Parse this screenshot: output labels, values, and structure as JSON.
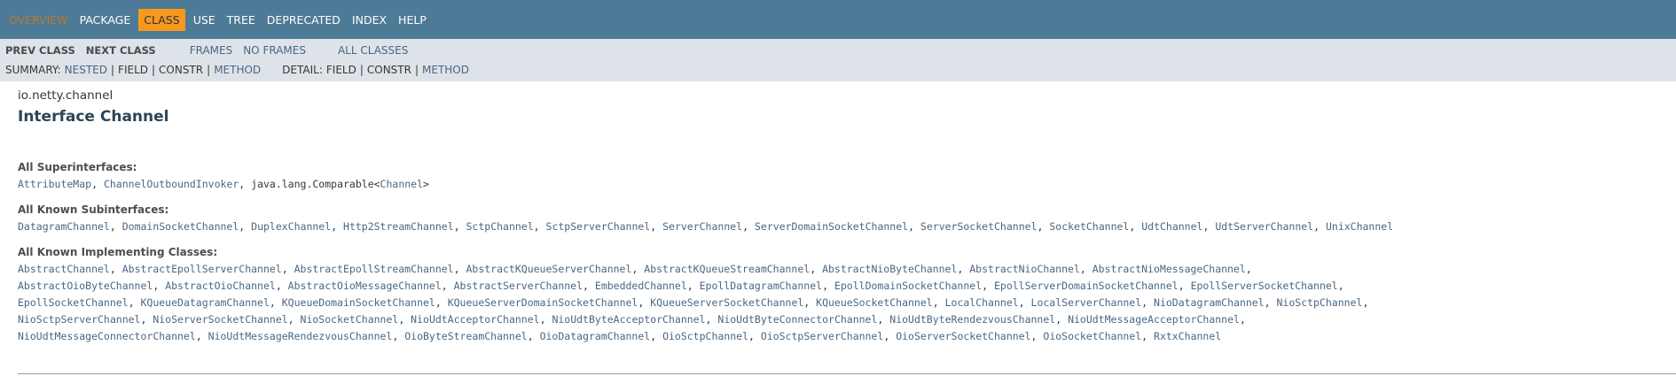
{
  "topnav": {
    "items": [
      {
        "label": "OVERVIEW"
      },
      {
        "label": "PACKAGE"
      },
      {
        "label": "CLASS"
      },
      {
        "label": "USE"
      },
      {
        "label": "TREE"
      },
      {
        "label": "DEPRECATED"
      },
      {
        "label": "INDEX"
      },
      {
        "label": "HELP"
      }
    ]
  },
  "subnav": {
    "prev_class": "PREV CLASS",
    "next_class": "NEXT CLASS",
    "frames": "FRAMES",
    "no_frames": "NO FRAMES",
    "all_classes": "ALL CLASSES",
    "summary_label": "SUMMARY:",
    "summary_nested": "NESTED",
    "summary_field": "FIELD",
    "summary_constr": "CONSTR",
    "summary_method": "METHOD",
    "detail_label": "DETAIL:",
    "detail_field": "FIELD",
    "detail_constr": "CONSTR",
    "detail_method": "METHOD",
    "sep": "|"
  },
  "header": {
    "package": "io.netty.channel",
    "title": "Interface Channel"
  },
  "superinterfaces": {
    "heading": "All Superinterfaces:",
    "items": [
      {
        "text": "AttributeMap",
        "link": true
      },
      {
        "text": "ChannelOutboundInvoker",
        "link": true
      },
      {
        "text": "java.lang.Comparable<",
        "link": false
      },
      {
        "text": "Channel",
        "link": true
      },
      {
        "text": ">",
        "link": false
      }
    ]
  },
  "subinterfaces": {
    "heading": "All Known Subinterfaces:",
    "items": [
      "DatagramChannel",
      "DomainSocketChannel",
      "DuplexChannel",
      "Http2StreamChannel",
      "SctpChannel",
      "SctpServerChannel",
      "ServerChannel",
      "ServerDomainSocketChannel",
      "ServerSocketChannel",
      "SocketChannel",
      "UdtChannel",
      "UdtServerChannel",
      "UnixChannel"
    ]
  },
  "implementing": {
    "heading": "All Known Implementing Classes:",
    "items": [
      "AbstractChannel",
      "AbstractEpollServerChannel",
      "AbstractEpollStreamChannel",
      "AbstractKQueueServerChannel",
      "AbstractKQueueStreamChannel",
      "AbstractNioByteChannel",
      "AbstractNioChannel",
      "AbstractNioMessageChannel",
      "AbstractOioByteChannel",
      "AbstractOioChannel",
      "AbstractOioMessageChannel",
      "AbstractServerChannel",
      "EmbeddedChannel",
      "EpollDatagramChannel",
      "EpollDomainSocketChannel",
      "EpollServerDomainSocketChannel",
      "EpollServerSocketChannel",
      "EpollSocketChannel",
      "KQueueDatagramChannel",
      "KQueueDomainSocketChannel",
      "KQueueServerDomainSocketChannel",
      "KQueueServerSocketChannel",
      "KQueueSocketChannel",
      "LocalChannel",
      "LocalServerChannel",
      "NioDatagramChannel",
      "NioSctpChannel",
      "NioSctpServerChannel",
      "NioServerSocketChannel",
      "NioSocketChannel",
      "NioUdtAcceptorChannel",
      "NioUdtByteAcceptorChannel",
      "NioUdtByteConnectorChannel",
      "NioUdtByteRendezvousChannel",
      "NioUdtMessageAcceptorChannel",
      "NioUdtMessageConnectorChannel",
      "NioUdtMessageRendezvousChannel",
      "OioByteStreamChannel",
      "OioDatagramChannel",
      "OioSctpChannel",
      "OioSctpServerChannel",
      "OioServerSocketChannel",
      "OioSocketChannel",
      "RxtxChannel"
    ]
  }
}
